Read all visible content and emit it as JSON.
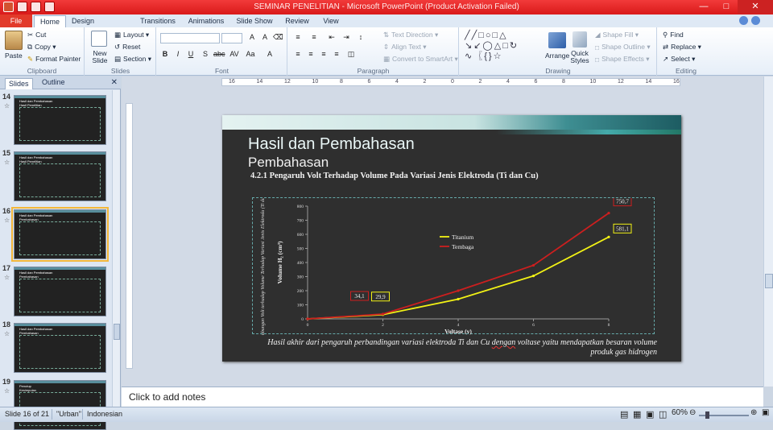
{
  "window": {
    "title": "SEMINAR PENELITIAN  -  Microsoft PowerPoint (Product Activation Failed)"
  },
  "tabs": [
    "File",
    "Home",
    "Design",
    "Transitions",
    "Animations",
    "Slide Show",
    "Review",
    "View"
  ],
  "ribbon": {
    "clipboard": {
      "group": "Clipboard",
      "paste": "Paste",
      "cut": "Cut",
      "copy": "Copy",
      "format_painter": "Format Painter"
    },
    "slides": {
      "group": "Slides",
      "new_slide": "New Slide",
      "layout": "Layout",
      "reset": "Reset",
      "section": "Section"
    },
    "font": {
      "group": "Font",
      "font_name": "",
      "font_size": ""
    },
    "paragraph": {
      "group": "Paragraph",
      "text_direction": "Text Direction",
      "align_text": "Align Text",
      "convert_smartart": "Convert to SmartArt"
    },
    "drawing": {
      "group": "Drawing",
      "arrange": "Arrange",
      "quick_styles": "Quick Styles",
      "shape_fill": "Shape Fill",
      "shape_outline": "Shape Outline",
      "shape_effects": "Shape Effects"
    },
    "editing": {
      "group": "Editing",
      "find": "Find",
      "replace": "Replace",
      "select": "Select"
    }
  },
  "leftpane": {
    "tabs": [
      "Slides",
      "Outline"
    ],
    "thumbs": [
      {
        "num": "14",
        "title": "Hasil dan Pembahasan",
        "sub": "Hasil Penelitian"
      },
      {
        "num": "15",
        "title": "Hasil dan Pembahasan",
        "sub": "Hasil Penelitian"
      },
      {
        "num": "16",
        "title": "Hasil dan Pembahasan",
        "sub": "Pembahasan"
      },
      {
        "num": "17",
        "title": "Hasil dan Pembahasan",
        "sub": "Pembahasan"
      },
      {
        "num": "18",
        "title": "Hasil dan Pembahasan",
        "sub": "Pembahasan"
      },
      {
        "num": "19",
        "title": "Penutup",
        "sub": "Kesimpulan"
      }
    ]
  },
  "ruler": {
    "h_ticks": [
      "16",
      "14",
      "12",
      "10",
      "8",
      "6",
      "4",
      "2",
      "0",
      "2",
      "4",
      "6",
      "8",
      "10",
      "12",
      "14",
      "16"
    ]
  },
  "slide": {
    "title": "Hasil dan Pembahasan",
    "subtitle": "Pembahasan",
    "heading": "4.2.1  Pengaruh Volt Terhadap Volume Pada Variasi Jenis Elektroda (Ti dan Cu)",
    "caption_a": "Hasil akhir dari pengaruh perbandingan variasi elektroda Ti dan Cu ",
    "caption_ul": "dengan",
    "caption_b": " voltase yaitu mendapatkan besaran volume produk gas hidrogen",
    "side_label_1": "Grafik 4.1",
    "side_label_2": "Hubungan Volt terhadap Volume Terhadap Variasi Jenis Elektroda (Ti dan Cu)"
  },
  "chart_data": {
    "type": "line",
    "x": [
      0,
      2,
      4,
      6,
      8
    ],
    "series": [
      {
        "name": "Titanium",
        "color": "#f2f215",
        "values": [
          0,
          29.9,
          140,
          305,
          581.1
        ]
      },
      {
        "name": "Tembaga",
        "color": "#cc1f1f",
        "values": [
          0,
          34.1,
          200,
          380,
          750.7
        ]
      }
    ],
    "xlabel": "Voltase (v)",
    "ylabel": "Volume H₂ (cm³)",
    "yticks": [
      "0",
      "100",
      "200",
      "300",
      "400",
      "500",
      "600",
      "700",
      "800"
    ],
    "xticks": [
      "0",
      "2",
      "4",
      "6",
      "8"
    ],
    "ylim": [
      0,
      800
    ],
    "xlim": [
      0,
      8
    ],
    "annotations": [
      "34,1",
      "29,9",
      "750,7",
      "581,1"
    ],
    "legend_position": "center",
    "grid": false
  },
  "notes": {
    "placeholder": "Click to add notes"
  },
  "status": {
    "slide": "Slide 16 of 21",
    "theme": "\"Urban\"",
    "language": "Indonesian",
    "zoom": "60%"
  }
}
